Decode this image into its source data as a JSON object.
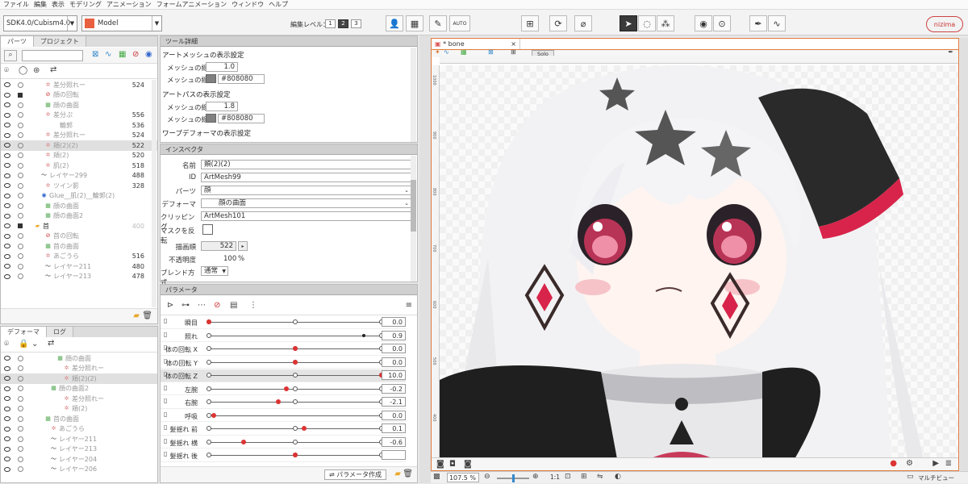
{
  "menu": [
    "ファイル",
    "編集",
    "表示",
    "モデリング",
    "アニメーション",
    "フォームアニメーション",
    "ウィンドウ",
    "ヘルプ"
  ],
  "toolbar": {
    "sdk_version": "SDK4.0/Cubism4.0",
    "model_label": "Model",
    "edit_level_label": "編集レベル：",
    "edit_levels": [
      "1",
      "2",
      "3"
    ],
    "auto_label": "AUTO",
    "logo": "nizima"
  },
  "parts_panel": {
    "tabs": [
      "パーツ",
      "プロジェクト"
    ],
    "rows": [
      {
        "label": "差分照れー",
        "num": "524",
        "indent": 55,
        "icon": "mesh"
      },
      {
        "label": "顔の回転",
        "num": "",
        "indent": 55,
        "icon": "rotate",
        "lock": true
      },
      {
        "label": "顔の曲面",
        "num": "",
        "indent": 55,
        "icon": "warp"
      },
      {
        "label": "差分ぷ",
        "num": "556",
        "indent": 55,
        "icon": "mesh"
      },
      {
        "label": "輪郭",
        "num": "536",
        "indent": 63,
        "icon": "none"
      },
      {
        "label": "差分照れー",
        "num": "524",
        "indent": 55,
        "icon": "mesh"
      },
      {
        "label": "頬(2)(2)",
        "num": "522",
        "indent": 55,
        "icon": "mesh",
        "hl": true
      },
      {
        "label": "頬(2)",
        "num": "520",
        "indent": 55,
        "icon": "mesh"
      },
      {
        "label": "肌(2)",
        "num": "518",
        "indent": 55,
        "icon": "mesh"
      },
      {
        "label": "レイヤー299",
        "num": "488",
        "indent": 50,
        "icon": "stroke"
      },
      {
        "label": "ツイン影",
        "num": "328",
        "indent": 55,
        "icon": "mesh"
      },
      {
        "label": "Glue__肌(2)__輪郭(2)",
        "num": "",
        "indent": 50,
        "icon": "glue"
      },
      {
        "label": "顔の曲面",
        "num": "",
        "indent": 55,
        "icon": "warp"
      },
      {
        "label": "顔の曲面2",
        "num": "",
        "indent": 55,
        "icon": "warp"
      },
      {
        "label": "首",
        "num": "400",
        "indent": 42,
        "icon": "folder",
        "lock": true
      },
      {
        "label": "首の回転",
        "num": "",
        "indent": 55,
        "icon": "rotate"
      },
      {
        "label": "首の曲面",
        "num": "",
        "indent": 55,
        "icon": "warp"
      },
      {
        "label": "あごうら",
        "num": "516",
        "indent": 55,
        "icon": "mesh"
      },
      {
        "label": "レイヤー211",
        "num": "480",
        "indent": 55,
        "icon": "stroke"
      },
      {
        "label": "レイヤー213",
        "num": "478",
        "indent": 55,
        "icon": "stroke"
      }
    ]
  },
  "deformer_panel": {
    "tabs": [
      "デフォーマ",
      "ログ"
    ],
    "rows": [
      {
        "label": "顔の曲面",
        "indent": 70,
        "icon": "warp"
      },
      {
        "label": "差分照れー",
        "indent": 78,
        "icon": "mesh"
      },
      {
        "label": "頬(2)(2)",
        "indent": 78,
        "icon": "mesh",
        "hl": true
      },
      {
        "label": "顔の曲面2",
        "indent": 62,
        "icon": "warp"
      },
      {
        "label": "差分照れー",
        "indent": 78,
        "icon": "mesh"
      },
      {
        "label": "頬(2)",
        "indent": 78,
        "icon": "mesh"
      },
      {
        "label": "首の曲面",
        "indent": 55,
        "icon": "warp"
      },
      {
        "label": "あごうら",
        "indent": 62,
        "icon": "mesh"
      },
      {
        "label": "レイヤー211",
        "indent": 62,
        "icon": "stroke"
      },
      {
        "label": "レイヤー213",
        "indent": 62,
        "icon": "stroke"
      },
      {
        "label": "レイヤー204",
        "indent": 62,
        "icon": "stroke"
      },
      {
        "label": "レイヤー206",
        "indent": 62,
        "icon": "stroke"
      }
    ]
  },
  "tool_detail": {
    "title": "ツール詳細",
    "sections": [
      {
        "header": "アートメッシュの表示設定",
        "width_label": "メッシュの線幅",
        "width": "1.0",
        "color_label": "メッシュの線色",
        "color_hex": "#808080"
      },
      {
        "header": "アートパスの表示設定",
        "width_label": "メッシュの線幅",
        "width": "1.8",
        "color_label": "メッシュの線色",
        "color_hex": "#808080"
      },
      {
        "header": "ワープデフォーマの表示設定"
      }
    ]
  },
  "inspector": {
    "title": "インスペクタ",
    "fields": {
      "name_label": "名前",
      "name": "頬(2)(2)",
      "id_label": "ID",
      "id": "ArtMesh99",
      "parts_label": "パーツ",
      "parts": "顔",
      "deformer_label": "デフォーマ",
      "deformer": "顔の曲面",
      "clipping_label": "クリッピング",
      "clipping": "ArtMesh101",
      "invert_mask_label": "マスクを反転",
      "draw_order_label": "描画順",
      "draw_order": "522",
      "opacity_label": "不透明度",
      "opacity": "100",
      "opacity_unit": "%",
      "blend_label": "ブレンド方式",
      "blend": "通常"
    }
  },
  "parameters": {
    "title": "パラメータ",
    "create_button": "パラメータ作成",
    "rows": [
      {
        "name": "瞬目",
        "value": "0.0",
        "pos": 0.0,
        "kind": "red",
        "marks": [
          0,
          0.5,
          1
        ]
      },
      {
        "name": "照れ",
        "value": "0.9",
        "pos": 0.9,
        "kind": "black",
        "marks": [
          0,
          1
        ]
      },
      {
        "name": "体の回転 X",
        "value": "0.0",
        "pos": 0.5,
        "kind": "red",
        "marks": [
          0,
          0.5,
          1
        ]
      },
      {
        "name": "体の回転 Y",
        "value": "0.0",
        "pos": 0.5,
        "kind": "red",
        "marks": [
          0,
          0.5,
          1
        ]
      },
      {
        "name": "体の回転 Z",
        "value": "10.0",
        "pos": 1.0,
        "kind": "red",
        "marks": [
          0,
          0.5,
          1
        ],
        "hl": true
      },
      {
        "name": "左腕",
        "value": "-0.2",
        "pos": 0.45,
        "kind": "red",
        "marks": [
          0,
          0.5,
          1
        ]
      },
      {
        "name": "右腕",
        "value": "-2.1",
        "pos": 0.4,
        "kind": "red",
        "marks": [
          0,
          0.5,
          1
        ]
      },
      {
        "name": "呼吸",
        "value": "0.0",
        "pos": 0.03,
        "kind": "red",
        "marks": [
          0,
          1
        ]
      },
      {
        "name": "髪揺れ 前",
        "value": "0.1",
        "pos": 0.55,
        "kind": "red",
        "marks": [
          0,
          0.5,
          1
        ]
      },
      {
        "name": "髪揺れ 横",
        "value": "-0.6",
        "pos": 0.2,
        "kind": "red",
        "marks": [
          0,
          0.5,
          1
        ]
      },
      {
        "name": "髪揺れ 後",
        "value": "",
        "pos": 0.5,
        "kind": "red",
        "marks": [
          0,
          0.5,
          1
        ]
      }
    ]
  },
  "viewport": {
    "tab_label": "* bone",
    "solo_label": "Solo",
    "ruler_labels": [
      "1000",
      "900",
      "800",
      "700",
      "600",
      "500",
      "400",
      "300"
    ],
    "zoom": "107.5 %",
    "ratio": "1:1",
    "multiview_label": "マルチビュー"
  },
  "colors": {
    "accent": "#e07a3a",
    "selection": "#d33333"
  }
}
